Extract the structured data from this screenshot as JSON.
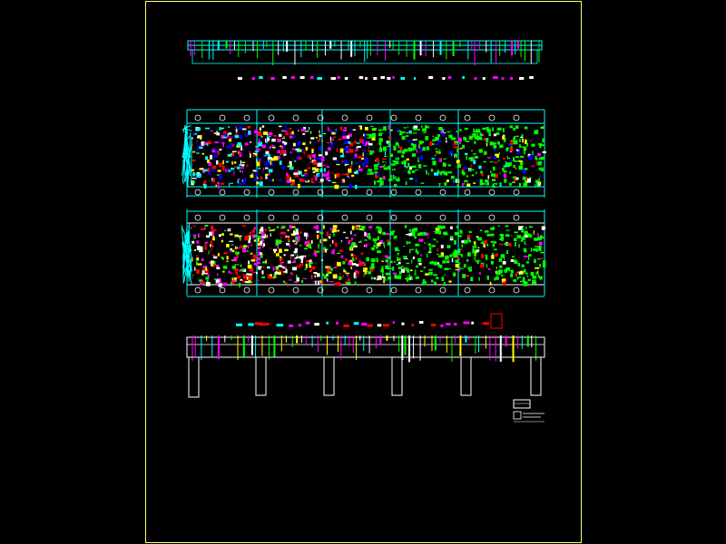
{
  "canvas": {
    "background": "#000000",
    "frame_color": "#ffff66"
  },
  "palette": {
    "cyan": "#00ffff",
    "green": "#00ff00",
    "magenta": "#ff00ff",
    "white": "#ffffff",
    "blue": "#0000ff",
    "red": "#ff0000",
    "yellow": "#ffff00"
  },
  "views": [
    {
      "id": "top-elevation",
      "kind": "elevation"
    },
    {
      "id": "plan-upper",
      "kind": "plan"
    },
    {
      "id": "plan-lower",
      "kind": "plan"
    },
    {
      "id": "side-elevation",
      "kind": "elevation"
    }
  ],
  "legend": {
    "visible": true
  }
}
